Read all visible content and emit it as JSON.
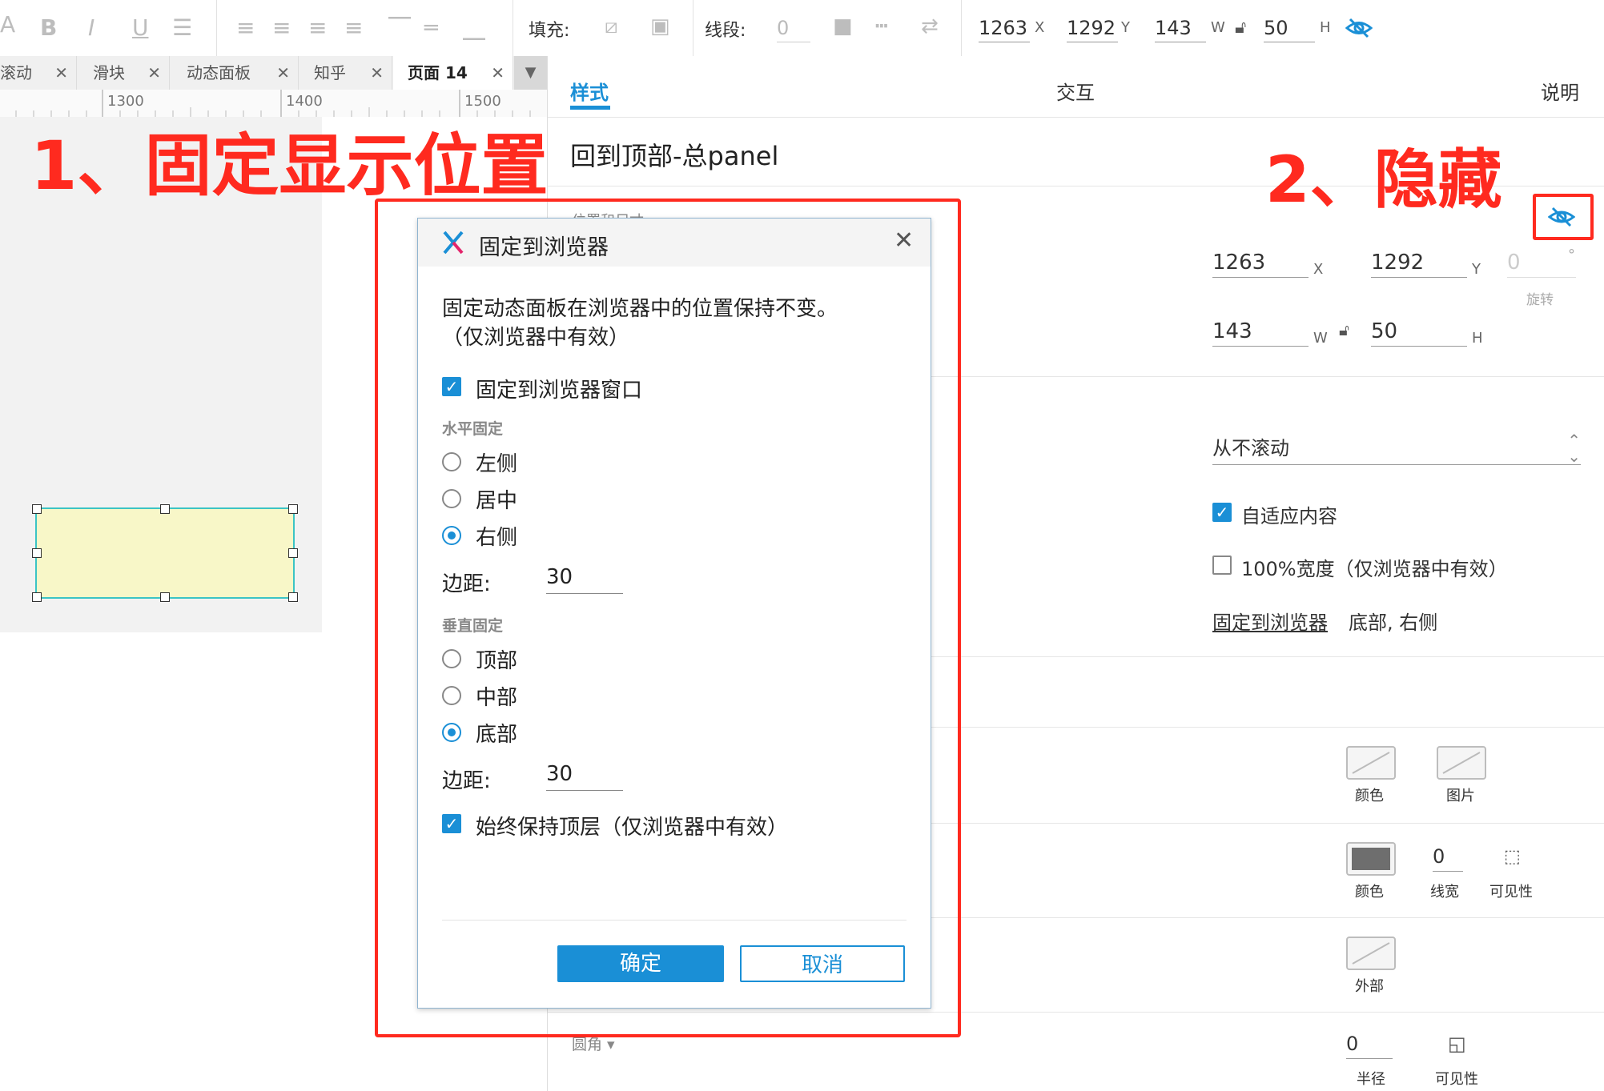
{
  "toolbar": {
    "fill_label": "填充:",
    "stroke_label": "线段:",
    "stroke_value": "0",
    "x": "1263",
    "x_unit": "X",
    "y": "1292",
    "y_unit": "Y",
    "w": "143",
    "w_unit": "W",
    "h": "50",
    "h_unit": "H"
  },
  "tabs": [
    {
      "label": "滚动"
    },
    {
      "label": "滑块"
    },
    {
      "label": "动态面板"
    },
    {
      "label": "知乎"
    },
    {
      "label": "页面 14"
    }
  ],
  "ruler": {
    "t1": "1300",
    "t2": "1400",
    "t3": "1500"
  },
  "annotations": {
    "left": "1、固定显示位置",
    "right": "2、隐藏"
  },
  "inspector": {
    "tab_style": "样式",
    "tab_interact": "交互",
    "tab_notes": "说明",
    "widget_name": "回到顶部-总panel",
    "section_pos": "位置和尺寸",
    "x": "1263",
    "x_unit": "X",
    "y": "1292",
    "y_unit": "Y",
    "rotate": "0",
    "rotate_unit": "°",
    "rotate_label": "旋转",
    "w": "143",
    "w_unit": "W",
    "h": "50",
    "h_unit": "H",
    "scroll_select": "从不滚动",
    "fit_content": "自适应内容",
    "full_width": "100%宽度（仅浏览器中有效）",
    "pin_link": "固定到浏览器",
    "pin_value": "底部, 右侧",
    "fill_color": "颜色",
    "fill_image": "图片",
    "border_color": "颜色",
    "border_width": "0",
    "border_width_label": "线宽",
    "border_visibility": "可见性",
    "shadow_outer": "外部",
    "corner_label": "圆角",
    "corner_radius": "0",
    "corner_radius_label": "半径",
    "corner_visibility": "可见性"
  },
  "dialog": {
    "title": "固定到浏览器",
    "description_line1": "固定动态面板在浏览器中的位置保持不变。",
    "description_line2": "（仅浏览器中有效）",
    "pin_checkbox": "固定到浏览器窗口",
    "horizontal_label": "水平固定",
    "h_left": "左侧",
    "h_center": "居中",
    "h_right": "右侧",
    "margin_label": "边距:",
    "h_margin": "30",
    "vertical_label": "垂直固定",
    "v_top": "顶部",
    "v_middle": "中部",
    "v_bottom": "底部",
    "v_margin": "30",
    "keep_top": "始终保持顶层（仅浏览器中有效）",
    "ok": "确定",
    "cancel": "取消"
  },
  "colors": {
    "accent": "#1a8fd6",
    "annotation_red": "#ff2a1f",
    "panel_fill": "#f8f7c8"
  }
}
